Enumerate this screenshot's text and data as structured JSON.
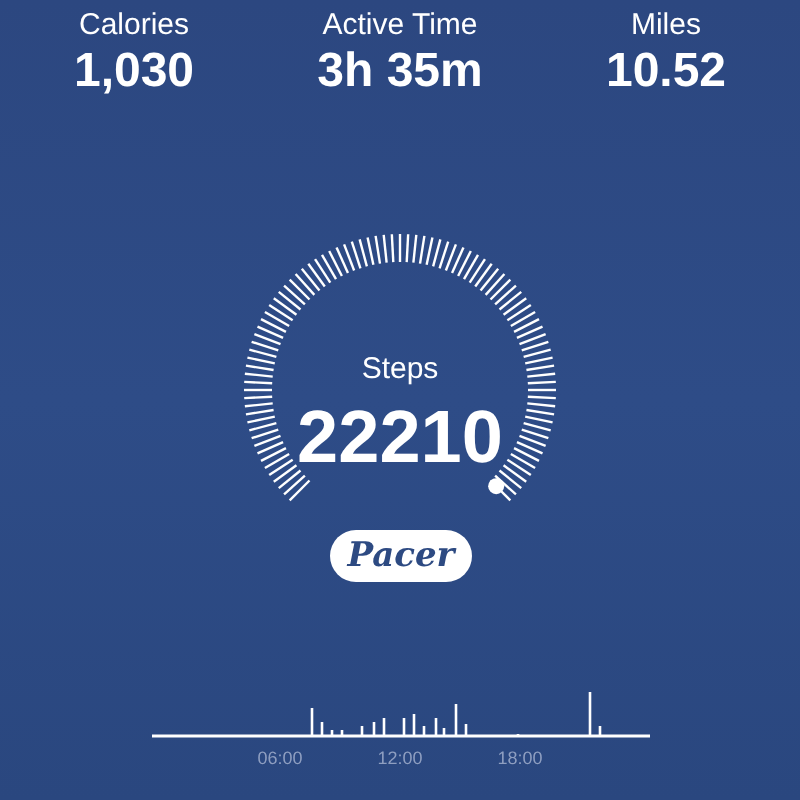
{
  "stats": [
    {
      "label": "Calories",
      "value": "1,030"
    },
    {
      "label": "Active Time",
      "value": "3h 35m"
    },
    {
      "label": "Miles",
      "value": "10.52"
    }
  ],
  "gauge": {
    "label": "Steps",
    "value": "22210"
  },
  "logo": "Pacer",
  "timeline": {
    "labels": [
      "06:00",
      "12:00",
      "18:00"
    ]
  }
}
